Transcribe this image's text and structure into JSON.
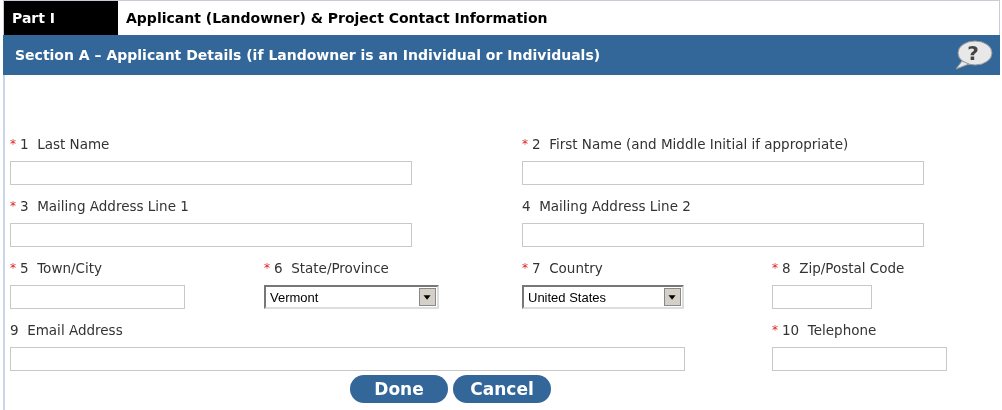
{
  "part": {
    "tag": "Part I",
    "title": "Applicant (Landowner) & Project Contact Information"
  },
  "section": {
    "title": "Section A – Applicant Details (if Landowner is an Individual or Individuals)",
    "help_icon": "?"
  },
  "fields": [
    {
      "kind": "text",
      "required": true,
      "label": "1  Last Name"
    },
    {
      "kind": "text",
      "required": true,
      "label": "2  First Name (and Middle Initial if appropriate)"
    },
    {
      "kind": "text",
      "required": true,
      "label": "3  Mailing Address Line 1"
    },
    {
      "kind": "text",
      "required": false,
      "label": "4  Mailing Address Line 2"
    },
    {
      "kind": "text",
      "required": true,
      "label": "5  Town/City"
    },
    {
      "kind": "select",
      "required": true,
      "label": "6  State/Province",
      "value": "Vermont"
    },
    {
      "kind": "select",
      "required": true,
      "label": "7  Country",
      "value": "United States"
    },
    {
      "kind": "text",
      "required": true,
      "label": "8  Zip/Postal Code"
    },
    {
      "kind": "text",
      "required": false,
      "label": "9  Email Address"
    },
    {
      "kind": "text",
      "required": true,
      "label": "10  Telephone"
    }
  ],
  "required_mark": "*",
  "buttons": [
    "Done",
    "Cancel"
  ]
}
